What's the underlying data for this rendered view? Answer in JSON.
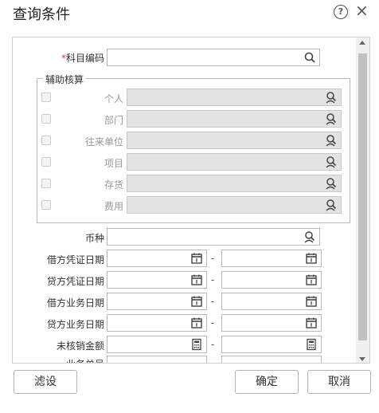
{
  "window": {
    "title": "查询条件",
    "help_icon": "?",
    "close_icon": "×"
  },
  "form": {
    "account_code_label": "科目编码",
    "required_mark": "*",
    "auxiliary": {
      "legend": "辅助核算",
      "items": [
        {
          "label": "个人"
        },
        {
          "label": "部门"
        },
        {
          "label": "往来单位"
        },
        {
          "label": "项目"
        },
        {
          "label": "存货"
        },
        {
          "label": "费用"
        }
      ]
    },
    "currency_label": "币种",
    "debit_voucher_date_label": "借方凭证日期",
    "credit_voucher_date_label": "贷方凭证日期",
    "debit_business_date_label": "借方业务日期",
    "credit_business_date_label": "贷方业务日期",
    "unverified_amount_label": "未核销金额",
    "business_no_label": "业务单号",
    "range_separator": "-"
  },
  "buttons": {
    "filter": "滤设",
    "ok": "确定",
    "cancel": "取消"
  }
}
